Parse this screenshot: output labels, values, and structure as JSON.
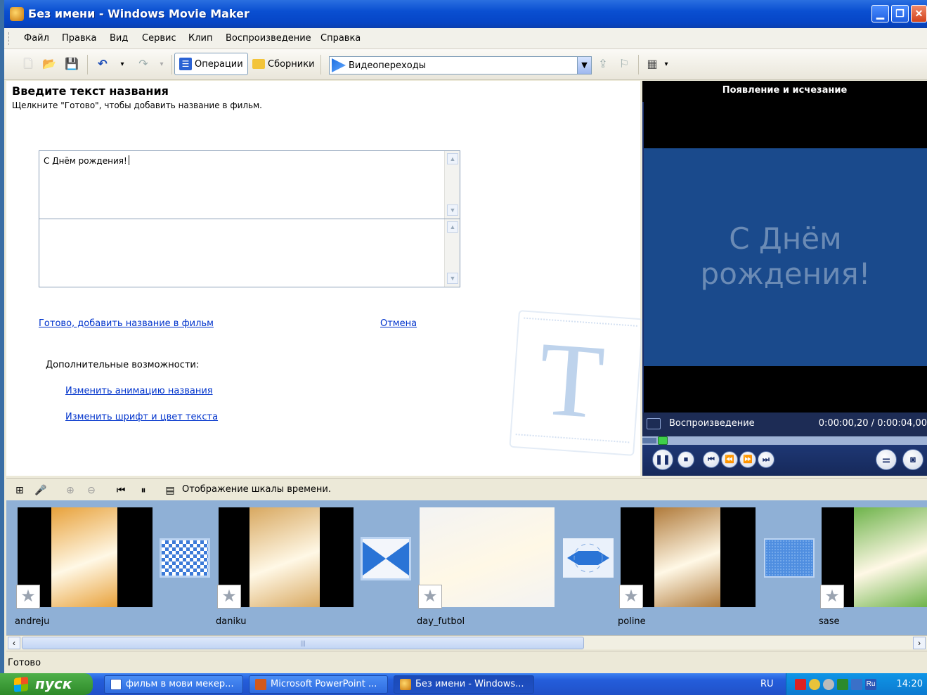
{
  "window": {
    "title": "Без имени - Windows Movie Maker"
  },
  "menu": [
    "Файл",
    "Правка",
    "Вид",
    "Сервис",
    "Клип",
    "Воспроизведение",
    "Справка"
  ],
  "toolbar": {
    "operations_label": "Операции",
    "collections_label": "Сборники",
    "collection_select": "Видеопереходы"
  },
  "task": {
    "heading": "Введите текст названия",
    "subtitle": "Щелкните \"Готово\", чтобы добавить название в фильм.",
    "title_text": "С Днём рождения!",
    "subtitle_text": "",
    "done_link": "Готово, добавить название в фильм",
    "cancel_link": "Отмена",
    "extra_label": "Дополнительные возможности:",
    "change_animation_link": "Изменить анимацию названия",
    "change_font_link": "Изменить шрифт и цвет текста"
  },
  "monitor": {
    "title": "Появление и исчезание",
    "screen_text": "С Днём рождения!",
    "status_label": "Воспроизведение",
    "time": "0:00:00,20 / 0:00:04,00",
    "progress": 0.05
  },
  "timeline": {
    "toggle_label": "Отображение шкалы времени.",
    "clips": [
      {
        "name": "andreju",
        "color": "#e8a13a"
      },
      {
        "name": "daniku",
        "color": "#d8a860"
      },
      {
        "name": "day_futbol",
        "color": "#f3f3f3"
      },
      {
        "name": "poline",
        "color": "#b07a3a"
      },
      {
        "name": "sase",
        "color": "#6db34a"
      }
    ]
  },
  "status": {
    "text": "Готово"
  },
  "taskbar": {
    "start_label": "пуск",
    "tasks": [
      "фильм в мови мекер...",
      "Microsoft PowerPoint ...",
      "Без имени - Windows..."
    ],
    "language": "RU",
    "clock": "14:20"
  }
}
